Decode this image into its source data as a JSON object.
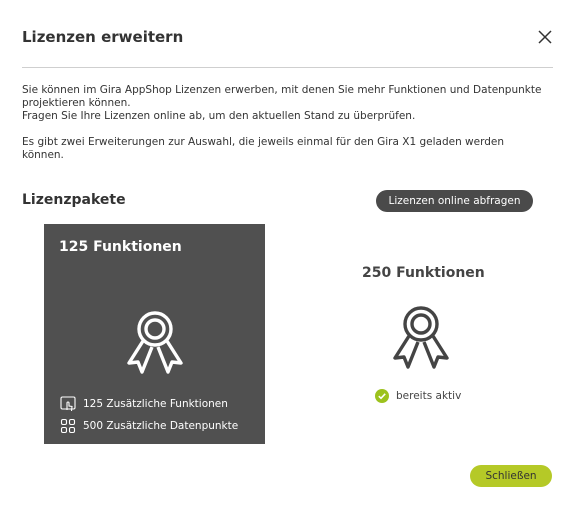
{
  "dialog": {
    "title": "Lizenzen erweitern",
    "intro_line1": "Sie können im Gira AppShop Lizenzen erwerben, mit denen Sie mehr Funktionen und Datenpunkte projektieren können.",
    "intro_line2": "Fragen Sie Ihre Lizenzen online ab, um den aktuellen Stand zu überprüfen.",
    "intro_line3": "Es gibt zwei Erweiterungen zur Auswahl, die jeweils einmal für den Gira X1 geladen werden können.",
    "close_icon": "close-icon"
  },
  "packages": {
    "title": "Lizenzpakete",
    "online_button": "Lizenzen online abfragen",
    "items": [
      {
        "title": "125 Funktionen",
        "icon": "award-icon",
        "features": [
          {
            "icon": "touch-hand-icon",
            "label": "125 Zusätzliche Funktionen"
          },
          {
            "icon": "datapoints-icon",
            "label": "500 Zusätzliche Datenpunkte"
          }
        ]
      },
      {
        "title": "250 Funktionen",
        "icon": "award-icon",
        "status": {
          "icon": "check-circle-icon",
          "label": "bereits aktiv"
        }
      }
    ]
  },
  "footer": {
    "close_button": "Schließen"
  },
  "colors": {
    "dark_card": "#505050",
    "accent_green": "#b5c927",
    "dark_button": "#4a4a4a"
  }
}
